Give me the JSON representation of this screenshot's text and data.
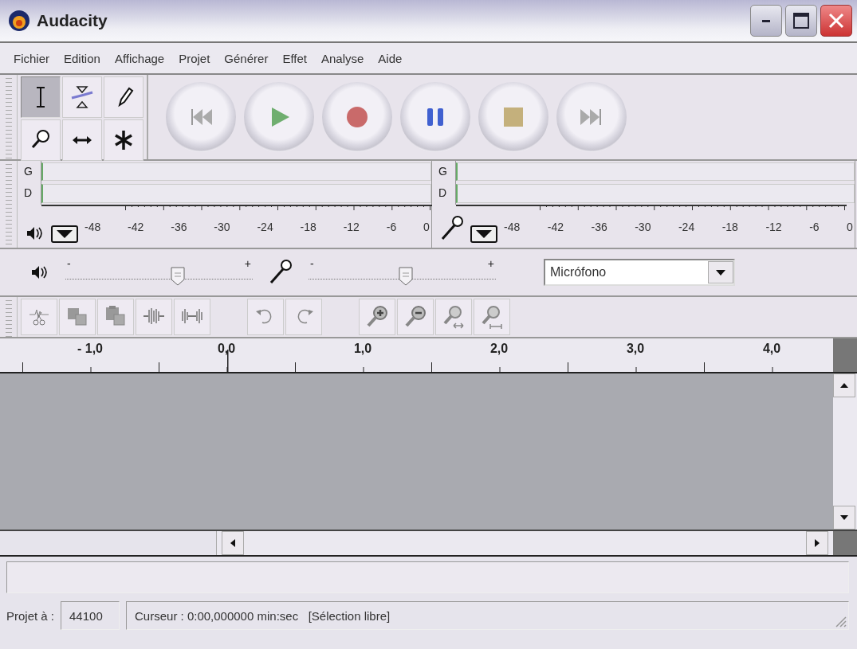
{
  "window": {
    "title": "Audacity"
  },
  "menu": [
    {
      "label": "Fichier"
    },
    {
      "label": "Edition"
    },
    {
      "label": "Affichage"
    },
    {
      "label": "Projet"
    },
    {
      "label": "Générer"
    },
    {
      "label": "Effet"
    },
    {
      "label": "Analyse"
    },
    {
      "label": "Aide"
    }
  ],
  "tools": [
    {
      "kind": "select",
      "selected": true
    },
    {
      "kind": "envelope",
      "selected": false
    },
    {
      "kind": "draw",
      "selected": false
    },
    {
      "kind": "zoom",
      "selected": false
    },
    {
      "kind": "timeshift",
      "selected": false
    },
    {
      "kind": "multi",
      "selected": false
    }
  ],
  "transport": [
    {
      "kind": "skip-start"
    },
    {
      "kind": "play"
    },
    {
      "kind": "record"
    },
    {
      "kind": "pause"
    },
    {
      "kind": "stop"
    },
    {
      "kind": "skip-end"
    }
  ],
  "meters": [
    {
      "kind": "playback",
      "channels": [
        "G",
        "D"
      ],
      "scale": [
        "-48",
        "-42",
        "-36",
        "-30",
        "-24",
        "-18",
        "-12",
        "-6",
        "0"
      ]
    },
    {
      "kind": "record",
      "channels": [
        "G",
        "D"
      ],
      "scale": [
        "-48",
        "-42",
        "-36",
        "-30",
        "-24",
        "-18",
        "-12",
        "-6",
        "0"
      ]
    }
  ],
  "mixer": {
    "sliders": [
      {
        "kind": "playback",
        "min_label": "-",
        "max_label": "+",
        "level": 0.6
      },
      {
        "kind": "record",
        "min_label": "-",
        "max_label": "+",
        "level": 0.52
      }
    ],
    "input_source": "Micrófono"
  },
  "edit_toolbar": [
    {
      "kind": "cut"
    },
    {
      "kind": "copy"
    },
    {
      "kind": "paste"
    },
    {
      "kind": "trim"
    },
    {
      "kind": "silence"
    },
    {
      "kind": "gap"
    },
    {
      "kind": "undo"
    },
    {
      "kind": "redo"
    },
    {
      "kind": "gap"
    },
    {
      "kind": "zoom-in"
    },
    {
      "kind": "zoom-out"
    },
    {
      "kind": "fit"
    },
    {
      "kind": "zoom-toggle"
    }
  ],
  "ruler": {
    "labels": [
      "- 1,0",
      "0,0",
      "1,0",
      "2,0",
      "3,0",
      "4,0"
    ]
  },
  "status_bar": {
    "rate_label": "Projet à :",
    "rate": "44100",
    "cursor": "Curseur : 0:00,000000 min:sec   [Sélection libre]"
  }
}
